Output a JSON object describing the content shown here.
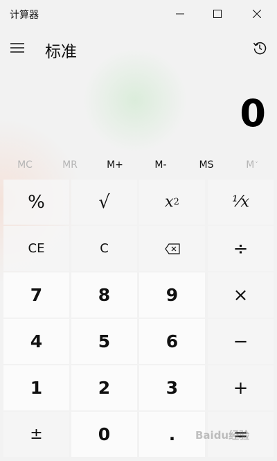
{
  "window": {
    "title": "计算器",
    "controls": {
      "minimize": "minimize-icon",
      "maximize": "maximize-icon",
      "close": "close-icon"
    }
  },
  "header": {
    "menu_icon": "hamburger-icon",
    "mode_title": "标准",
    "history_icon": "history-icon"
  },
  "display": {
    "value": "0"
  },
  "memory": {
    "buttons": [
      {
        "label": "MC",
        "enabled": false
      },
      {
        "label": "MR",
        "enabled": false
      },
      {
        "label": "M+",
        "enabled": true
      },
      {
        "label": "M-",
        "enabled": true
      },
      {
        "label": "MS",
        "enabled": true
      },
      {
        "label": "M",
        "enabled": false,
        "suffix": "˅"
      }
    ]
  },
  "keypad": {
    "percent": "%",
    "sqrt": "√",
    "square": "x",
    "square_exp": "2",
    "reciprocal": "¹⁄x",
    "ce": "CE",
    "c": "C",
    "backspace_icon": "backspace-icon",
    "divide": "÷",
    "seven": "7",
    "eight": "8",
    "nine": "9",
    "multiply": "×",
    "four": "4",
    "five": "5",
    "six": "6",
    "minus": "−",
    "one": "1",
    "two": "2",
    "three": "3",
    "plus": "+",
    "negate": "±",
    "zero": "0",
    "decimal": ".",
    "equals": "="
  },
  "watermark": {
    "text": "Baidu经验"
  },
  "colors": {
    "number_key": "#fbfbfb",
    "function_key": "#f6f6f6",
    "background": "#f2f2f2"
  }
}
